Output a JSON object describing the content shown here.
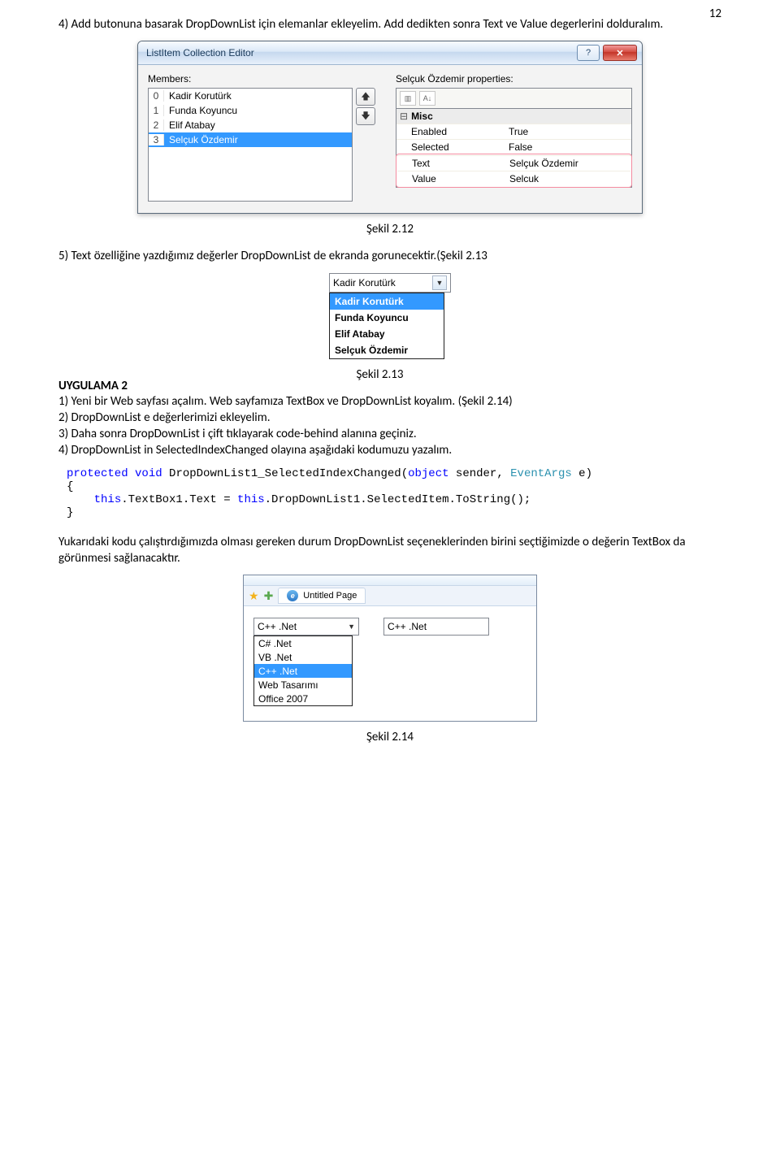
{
  "page_number": "12",
  "p4": "4) Add butonuna basarak DropDownList için elemanlar ekleyelim. Add dedikten sonra Text ve Value degerlerini dolduralım.",
  "caption1": "Şekil 2.12",
  "p5": "5) Text özelliğine yazdığımız değerler DropDownList de ekranda gorunecektir.(Şekil 2.13",
  "uygulama": "UYGULAMA 2",
  "caption2": "Şekil 2.13",
  "s1": "1) Yeni bir Web sayfası açalım. Web sayfamıza TextBox ve DropDownList koyalım. (Şekil 2.14)",
  "s2": "2) DropDownList e değerlerimizi ekleyelim.",
  "s3": "3) Daha sonra DropDownList i çift tıklayarak code-behind alanına geçiniz.",
  "s4": "4) DropDownList in SelectedIndexChanged olayına aşağıdaki kodumuzu yazalım.",
  "code": {
    "kw1": "protected",
    "kw2": "void",
    "method": " DropDownList1_SelectedIndexChanged(",
    "kw3": "object",
    "mid": " sender, ",
    "type": "EventArgs",
    "tail": " e)",
    "open": "{",
    "kw4": "this",
    "line2a": ".TextBox1.Text = ",
    "kw5": "this",
    "line2b": ".DropDownList1.SelectedItem.ToString();",
    "close": "}"
  },
  "para_bottom": "Yukarıdaki kodu çalıştırdığımızda olması gereken durum DropDownList seçeneklerinden birini seçtiğimizde o değerin TextBox da görünmesi sağlanacaktır.",
  "caption3": "Şekil 2.14",
  "dialog": {
    "title": "ListItem Collection Editor",
    "members_label": "Members:",
    "props_label": "Selçuk Özdemir properties:",
    "items": [
      {
        "idx": "0",
        "name": "Kadir Korutürk"
      },
      {
        "idx": "1",
        "name": "Funda Koyuncu"
      },
      {
        "idx": "2",
        "name": "Elif Atabay"
      },
      {
        "idx": "3",
        "name": "Selçuk Özdemir"
      }
    ],
    "misc": "Misc",
    "rows": {
      "enabled_k": "Enabled",
      "enabled_v": "True",
      "selected_k": "Selected",
      "selected_v": "False",
      "text_k": "Text",
      "text_v": "Selçuk Özdemir",
      "value_k": "Value",
      "value_v": "Selcuk"
    }
  },
  "dropdown": {
    "selected": "Kadir Korutürk",
    "items": [
      "Kadir Korutürk",
      "Funda Koyuncu",
      "Elif Atabay",
      "Selçuk Özdemir"
    ]
  },
  "browser": {
    "tab": "Untitled Page",
    "field_value": "C++ .Net",
    "textbox_value": "C++ .Net",
    "options": [
      "C# .Net",
      "VB .Net",
      "C++ .Net",
      "Web Tasarımı",
      "Office 2007"
    ]
  }
}
